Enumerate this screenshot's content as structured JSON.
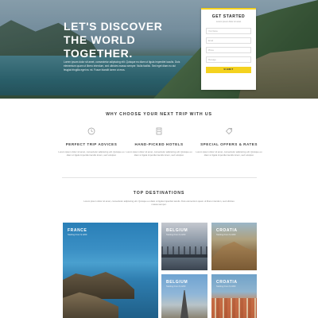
{
  "hero": {
    "title_lines": [
      "LET'S DISCOVER",
      "THE WORLD",
      "TOGETHER."
    ],
    "text": "Lorem ipsum dolor sit amet, consectetur adipiscing elit. Quisque eu diam ut ligula imperdiet iaculis. Duis elementum quam ut libero interdum, sed ultricies massa semper. Nulla facilisi. Sed eget diam eu dui feugiat fringilla eget eu mi. Fusce blandit lorem ut eros."
  },
  "form": {
    "title": "GET STARTED",
    "subtitle": "Lorem ipsum dolor sit amet",
    "fields": [
      "Your Name",
      "Email",
      "Phone",
      "Message"
    ],
    "submit_label": "SUBMIT",
    "accent_color": "#f4d21f"
  },
  "why": {
    "title": "WHY CHOOSE YOUR NEXT TRIP WITH US",
    "features": [
      {
        "icon": "clock-icon",
        "title": "PERFECT TRIP ADVICES",
        "text": "Lorem ipsum dolor sit amet, consectetur adipiscing elit. Quisque eu diam ut ligula imperdiet iaculis lorem, sed volutpat."
      },
      {
        "icon": "hotel-icon",
        "title": "HAND-PICKED HOTELS",
        "text": "Lorem ipsum dolor sit amet, consectetur adipiscing elit. Quisque eu diam ut ligula imperdiet iaculis lorem, sed volutpat."
      },
      {
        "icon": "tag-icon",
        "title": "SPECIAL OFFERS & RATES",
        "text": "Lorem ipsum dolor sit amet, consectetur adipiscing elit. Quisque eu diam ut ligula imperdiet iaculis lorem, sed volutpat."
      }
    ]
  },
  "destinations": {
    "title": "TOP DESTINATIONS",
    "text": "Lorem ipsum dolor sit amet, consectetur adipiscing elit. Quisque eu diam ut ligula imperdiet iaculis. Duis elementum quam ut libero interdum, sed ultricies massa semper.",
    "tiles": [
      {
        "name": "FRANCE",
        "sub": "Starting From $ 1200"
      },
      {
        "name": "BELGIUM",
        "sub": "Starting From $ 1200"
      },
      {
        "name": "CROATIA",
        "sub": "Starting From $ 1300"
      },
      {
        "name": "BELGIUM",
        "sub": "Starting From $ 1200"
      },
      {
        "name": "CROATIA",
        "sub": "Starting From $ 1300"
      }
    ]
  }
}
